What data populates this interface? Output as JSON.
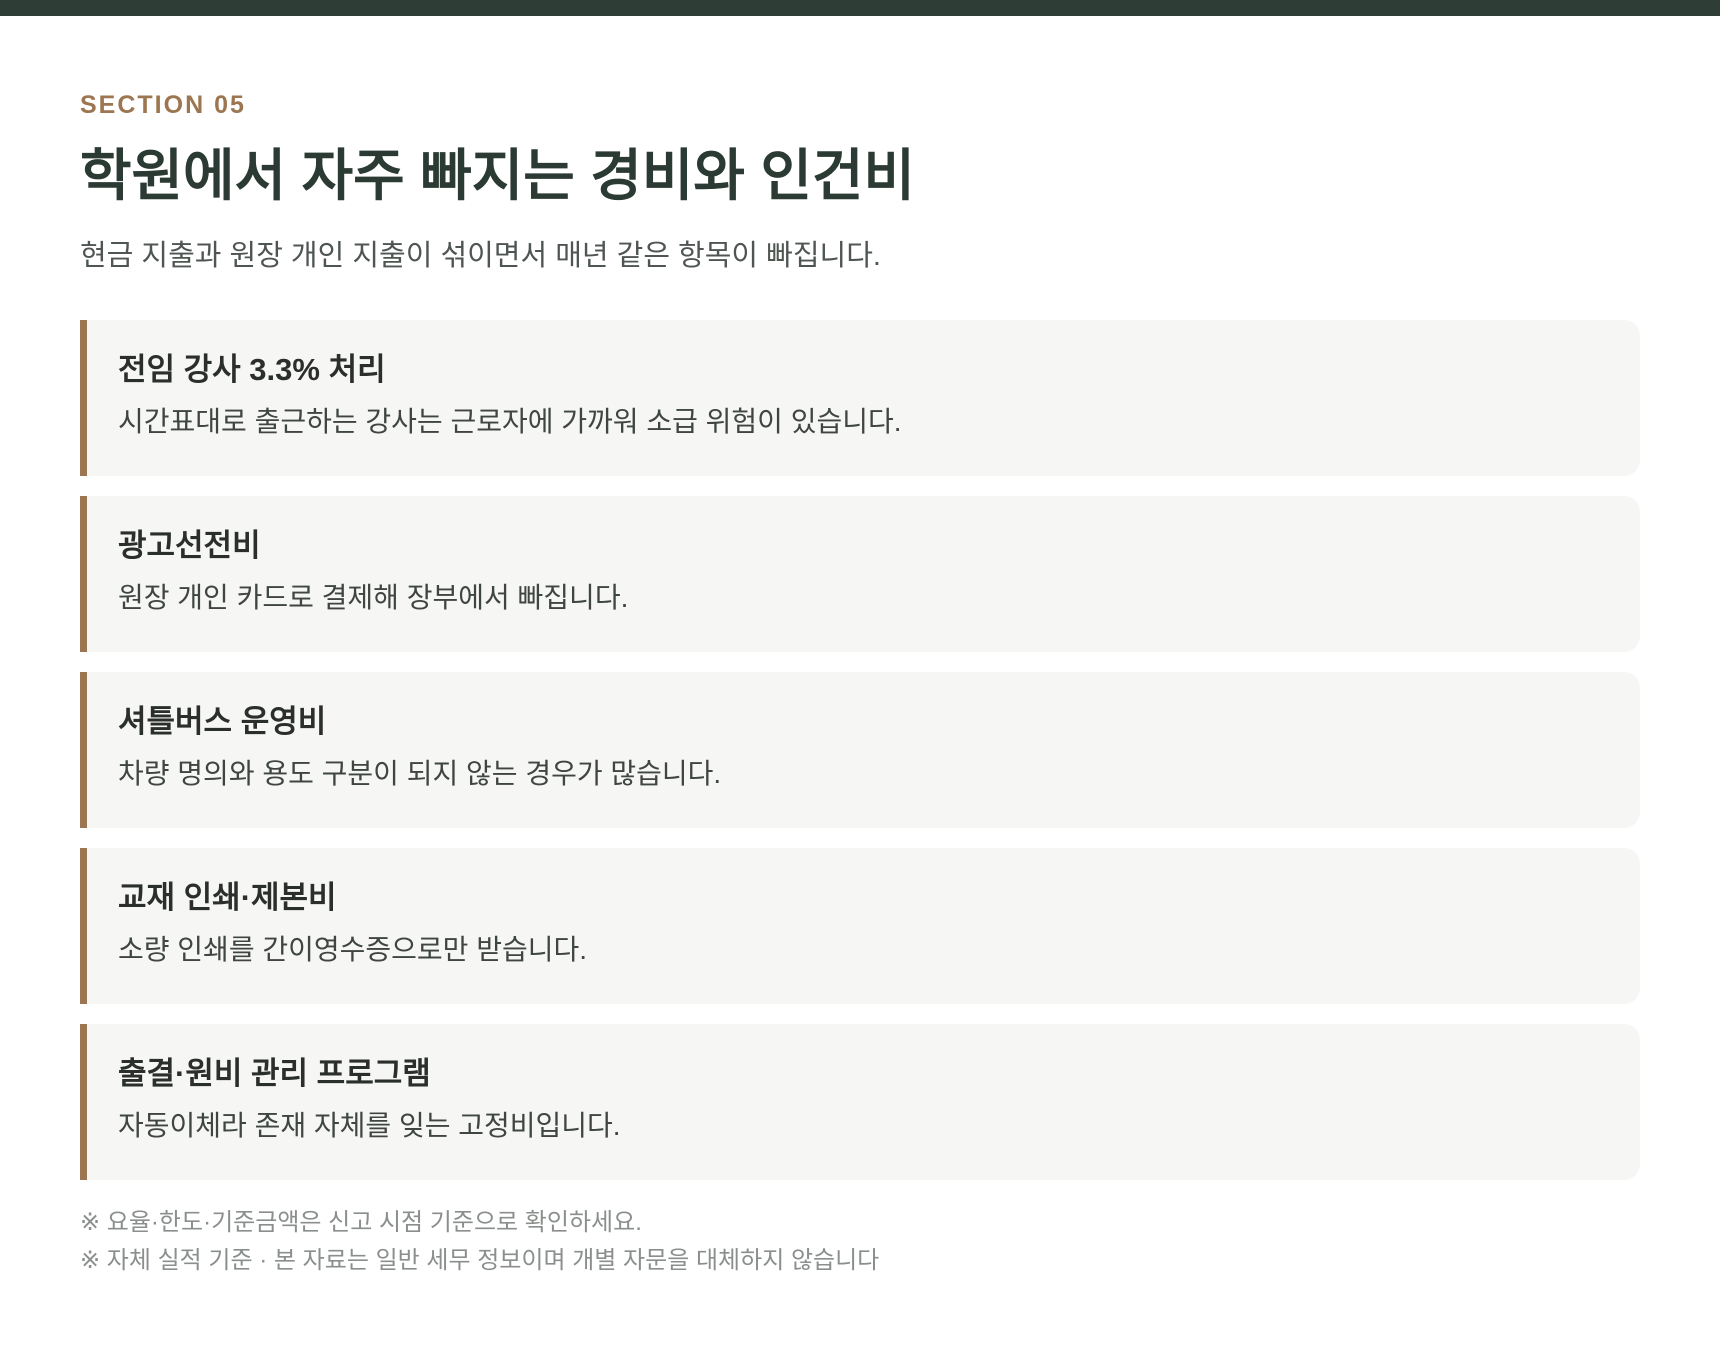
{
  "header": {
    "eyebrow": "SECTION 05",
    "title": "학원에서 자주 빠지는 경비와 인건비",
    "subtitle": "현금 지출과 원장 개인 지출이 섞이면서 매년 같은 항목이 빠집니다."
  },
  "items": [
    {
      "title": "전임 강사 3.3% 처리",
      "description": "시간표대로 출근하는 강사는 근로자에 가까워 소급 위험이 있습니다."
    },
    {
      "title": "광고선전비",
      "description": "원장 개인 카드로 결제해 장부에서 빠집니다."
    },
    {
      "title": "셔틀버스 운영비",
      "description": "차량 명의와 용도 구분이 되지 않는 경우가 많습니다."
    },
    {
      "title": "교재 인쇄·제본비",
      "description": "소량 인쇄를 간이영수증으로만 받습니다."
    },
    {
      "title": "출결·원비 관리 프로그램",
      "description": "자동이체라 존재 자체를 잊는 고정비입니다."
    }
  ],
  "notes": [
    "※ 요율·한도·기준금액은 신고 시점 기준으로 확인하세요.",
    "※ 자체 실적 기준 · 본 자료는 일반 세무 정보이며 개별 자문을 대체하지 않습니다"
  ],
  "colors": {
    "top_bar": "#2e3d36",
    "accent": "#9c7650",
    "card_background": "#f6f6f4"
  }
}
